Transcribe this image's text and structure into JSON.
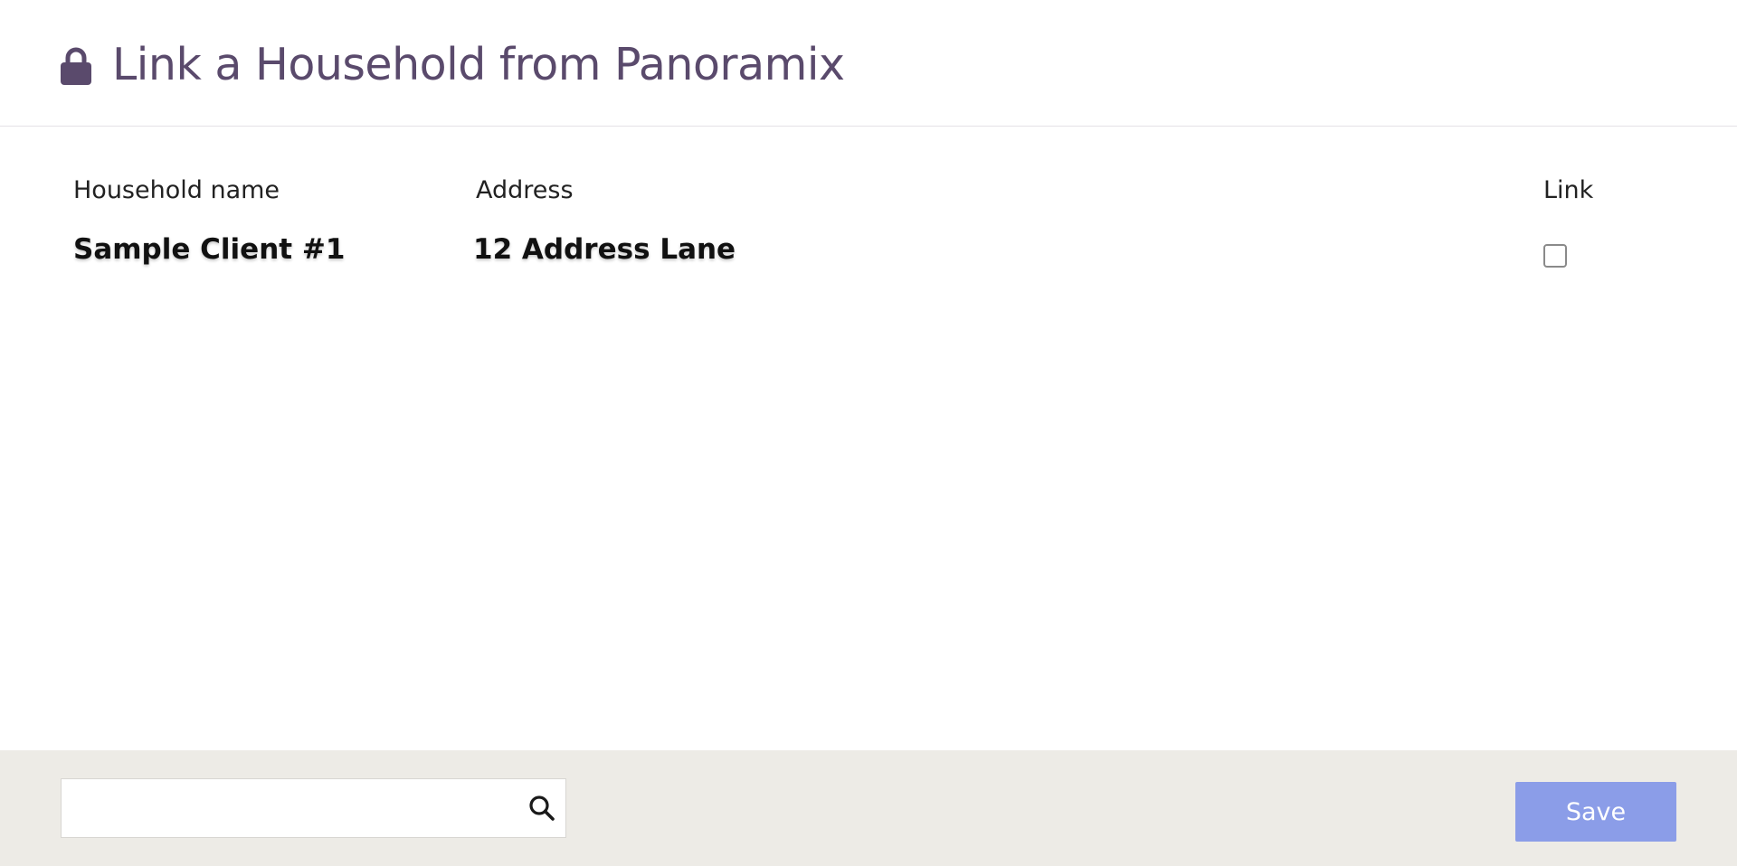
{
  "header": {
    "title": "Link a Household from Panoramix",
    "icon": "lock-icon",
    "title_color": "#5a4a6c"
  },
  "table": {
    "columns": [
      "Household name",
      "Address",
      "Link"
    ],
    "rows": [
      {
        "household_name": "Sample Client #1",
        "address": "12 Address Lane",
        "link_checked": false
      }
    ]
  },
  "footer": {
    "search": {
      "value": "",
      "placeholder": "",
      "icon": "search-icon"
    },
    "save_label": "Save",
    "save_color": "#8b9de8",
    "background_color": "#edebe6"
  }
}
